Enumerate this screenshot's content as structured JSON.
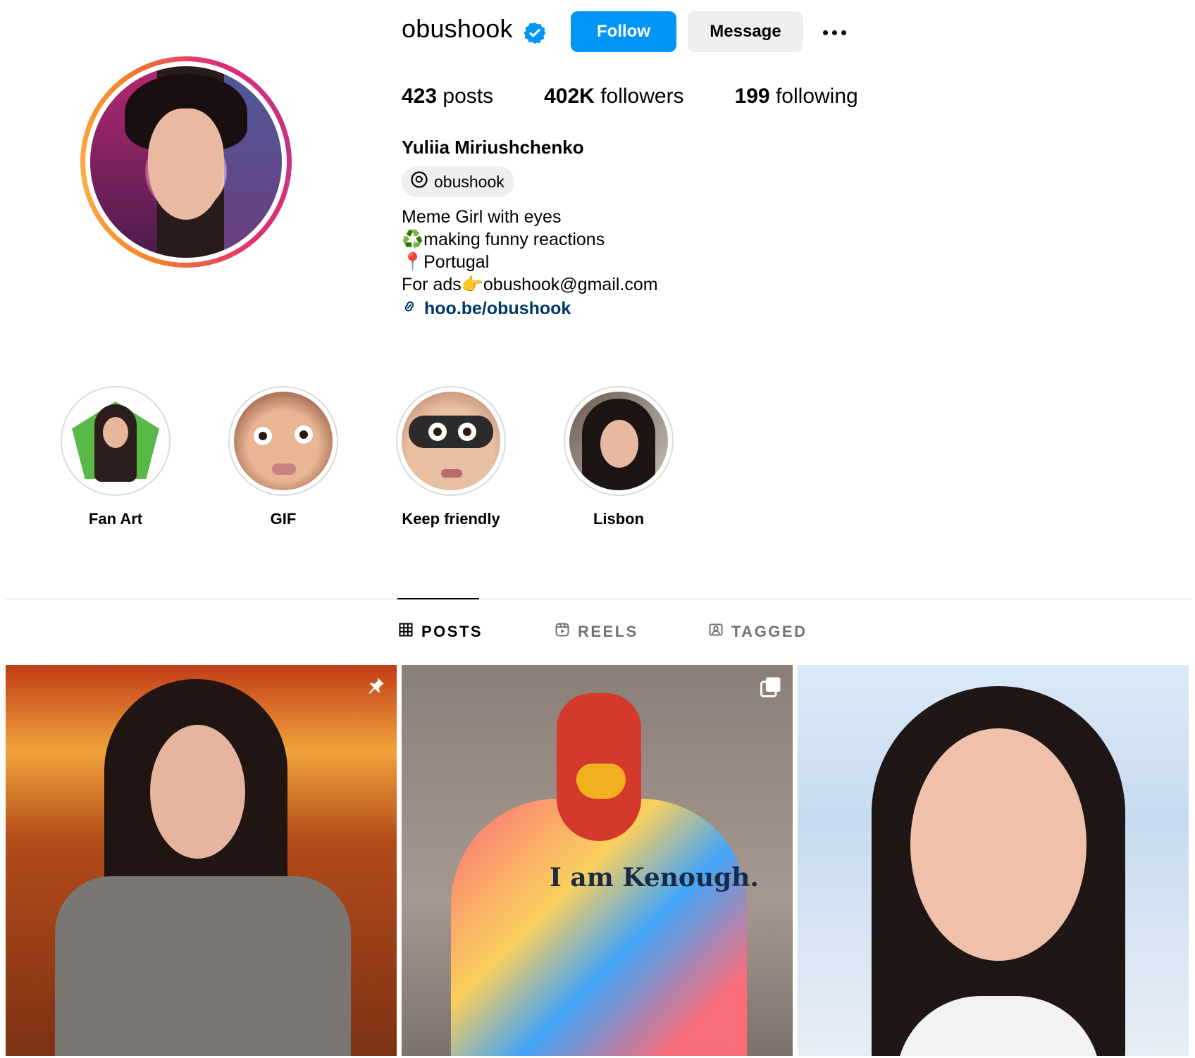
{
  "profile": {
    "username": "obushook",
    "verified": true,
    "full_name": "Yuliia Miriushchenko",
    "threads_handle": "obushook",
    "bio_lines": [
      "Meme Girl with eyes",
      "♻️making funny reactions",
      "📍Portugal",
      "For ads👉obushook@gmail.com"
    ],
    "link": "hoo.be/obushook",
    "stats": {
      "posts_count": "423",
      "posts_label": "posts",
      "followers_count": "402K",
      "followers_label": "followers",
      "following_count": "199",
      "following_label": "following"
    }
  },
  "actions": {
    "follow_label": "Follow",
    "message_label": "Message",
    "more_icon": "more-options-icon"
  },
  "highlights": [
    {
      "label": "Fan Art"
    },
    {
      "label": "GIF"
    },
    {
      "label": "Keep friendly"
    },
    {
      "label": "Lisbon"
    }
  ],
  "tabs": [
    {
      "label": "POSTS",
      "icon": "grid-icon",
      "active": true
    },
    {
      "label": "REELS",
      "icon": "reels-icon",
      "active": false
    },
    {
      "label": "TAGGED",
      "icon": "tagged-icon",
      "active": false
    }
  ],
  "posts": [
    {
      "badge_icon": "pin-icon",
      "caption_text": ""
    },
    {
      "badge_icon": "carousel-icon",
      "caption_text": "I am Kenough."
    },
    {
      "badge_icon": "",
      "caption_text": ""
    }
  ],
  "colors": {
    "follow_button": "#0095f6",
    "link": "#00376b",
    "verified_badge": "#0095f6"
  }
}
